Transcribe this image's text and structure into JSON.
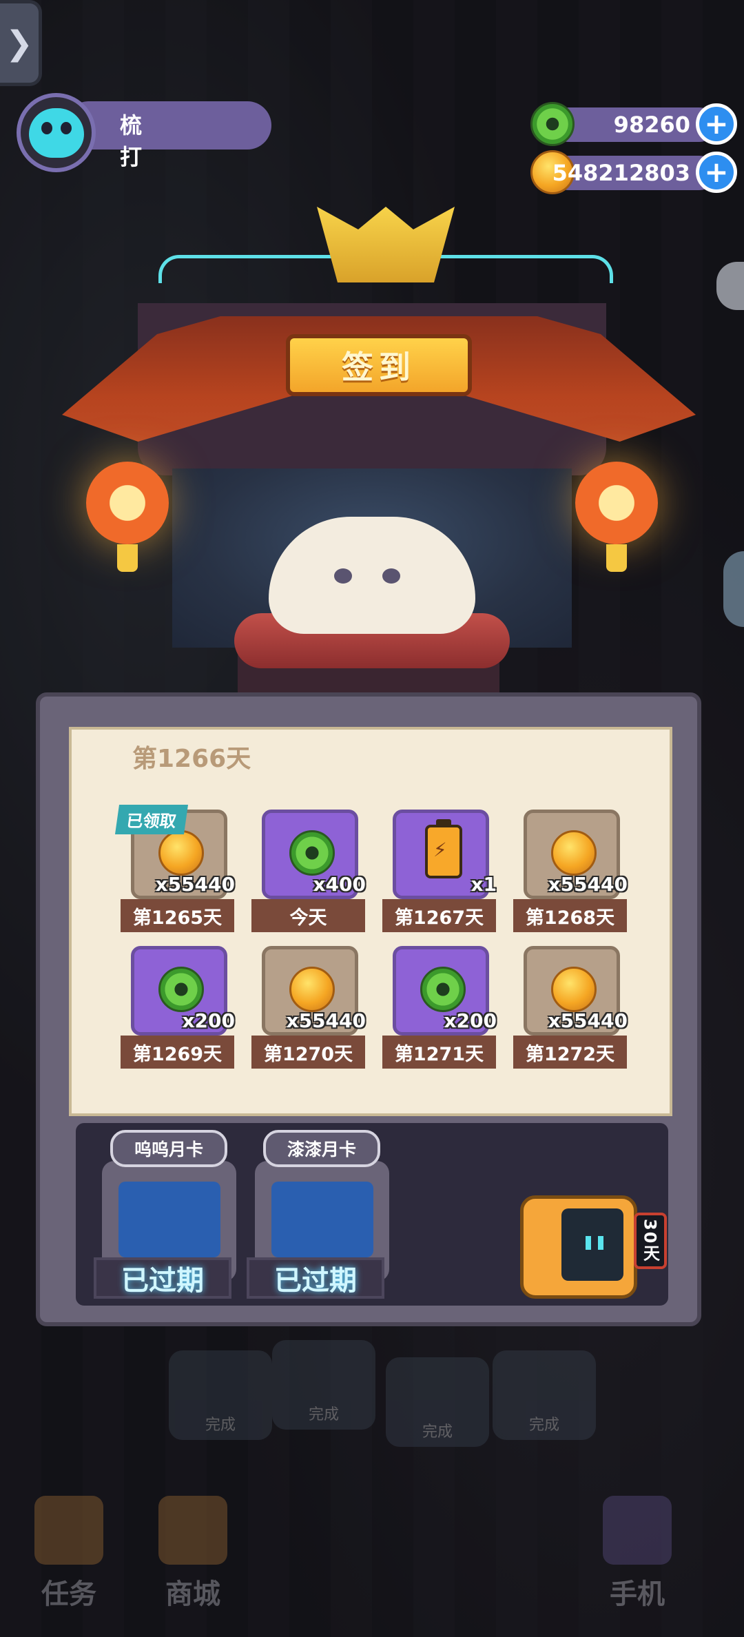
{
  "player": {
    "name": "梳打"
  },
  "currencies": [
    {
      "type": "jade",
      "value": "98260"
    },
    {
      "type": "gold",
      "value": "548212803"
    }
  ],
  "shrine": {
    "sign": "签到"
  },
  "signin": {
    "current_day": "第1266天",
    "claimed_badge": "已领取",
    "rewards": [
      {
        "icon": "gold",
        "qty": "x55440",
        "label": "第1265天",
        "claimed": true
      },
      {
        "icon": "jade",
        "qty": "x400",
        "label": "今天",
        "claimed": false
      },
      {
        "icon": "battery",
        "qty": "x1",
        "label": "第1267天",
        "claimed": false
      },
      {
        "icon": "gold",
        "qty": "x55440",
        "label": "第1268天",
        "claimed": false
      },
      {
        "icon": "jade",
        "qty": "x200",
        "label": "第1269天",
        "claimed": false
      },
      {
        "icon": "gold",
        "qty": "x55440",
        "label": "第1270天",
        "claimed": false
      },
      {
        "icon": "jade",
        "qty": "x200",
        "label": "第1271天",
        "claimed": false
      },
      {
        "icon": "gold",
        "qty": "x55440",
        "label": "第1272天",
        "claimed": false
      }
    ]
  },
  "month_cards": [
    {
      "title": "呜呜月卡",
      "status": "已过期"
    },
    {
      "title": "漆漆月卡",
      "status": "已过期"
    }
  ],
  "robot": {
    "days_label": "30天"
  },
  "nav": {
    "tasks": "任务",
    "shop": "商城",
    "phone": "手机"
  },
  "tasks": {
    "done_label": "完成"
  }
}
